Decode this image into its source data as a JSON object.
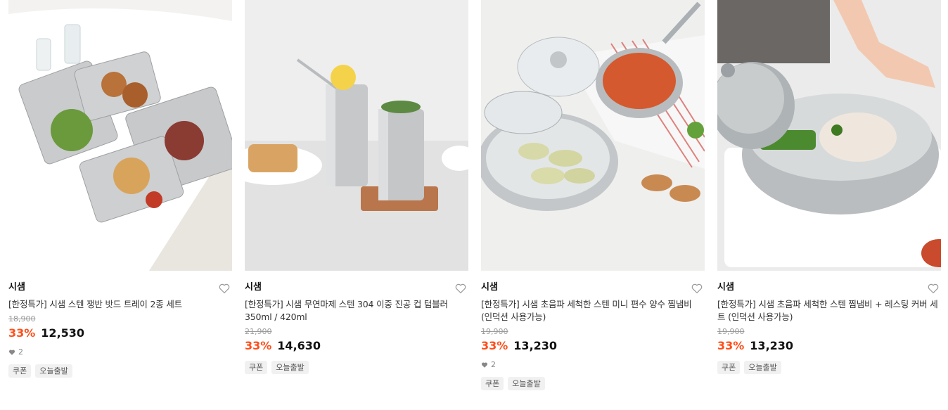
{
  "products": [
    {
      "brand": "시샘",
      "name": "[한정특가] 시샘 스텐 쟁반 밧드 트레이 2종 세트",
      "original_price": "18,900",
      "discount": "33%",
      "price": "12,530",
      "likes": "2",
      "badges": [
        "쿠폰",
        "오늘출발"
      ]
    },
    {
      "brand": "시샘",
      "name": "[한정특가] 시샘 무연마제 스텐 304 이중 진공 컵 텀블러 350ml / 420ml",
      "original_price": "21,900",
      "discount": "33%",
      "price": "14,630",
      "likes": null,
      "badges": [
        "쿠폰",
        "오늘출발"
      ]
    },
    {
      "brand": "시샘",
      "name": "[한정특가] 시샘 초음파 세척한 스텐 미니 편수 양수 찜냄비 (인덕션 사용가능)",
      "original_price": "19,900",
      "discount": "33%",
      "price": "13,230",
      "likes": "2",
      "badges": [
        "쿠폰",
        "오늘출발"
      ]
    },
    {
      "brand": "시샘",
      "name": "[한정특가] 시샘 초음파 세척한 스텐 찜냄비 + 레스팅 커버 세트 (인덕션 사용가능)",
      "original_price": "19,900",
      "discount": "33%",
      "price": "13,230",
      "likes": null,
      "badges": [
        "쿠폰",
        "오늘출발"
      ]
    }
  ],
  "colors": {
    "discount": "#ff4e1a",
    "badge_bg": "#f1f1f1"
  },
  "icons": {
    "wishlist": "heart-outline-icon",
    "likes": "heart-filled-icon"
  }
}
